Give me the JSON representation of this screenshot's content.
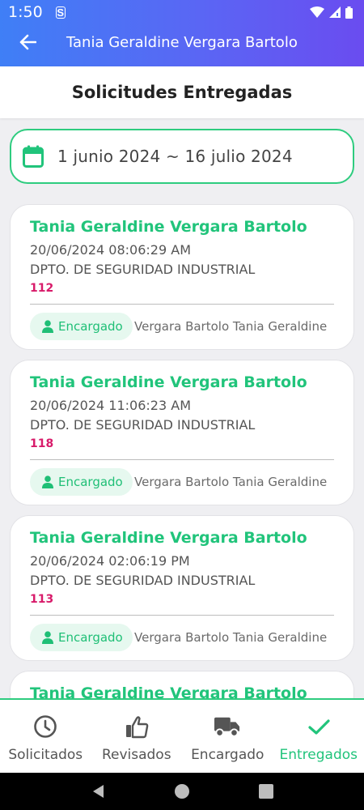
{
  "status": {
    "time": "1:50",
    "sim_label": "S"
  },
  "appbar": {
    "title": "Tania Geraldine Vergara Bartolo"
  },
  "header": {
    "title": "Solicitudes Entregadas"
  },
  "date_filter": {
    "range": "1 junio 2024 ~ 16 julio 2024"
  },
  "requests": [
    {
      "name": "Tania Geraldine Vergara Bartolo",
      "datetime": "20/06/2024 08:06:29 AM",
      "department": "DPTO. DE SEGURIDAD INDUSTRIAL",
      "number": "112",
      "role": "Encargado",
      "person": "Vergara Bartolo Tania Geraldine"
    },
    {
      "name": "Tania Geraldine Vergara Bartolo",
      "datetime": "20/06/2024 11:06:23 AM",
      "department": "DPTO. DE SEGURIDAD INDUSTRIAL",
      "number": "118",
      "role": "Encargado",
      "person": "Vergara Bartolo Tania Geraldine"
    },
    {
      "name": "Tania Geraldine Vergara Bartolo",
      "datetime": "20/06/2024 02:06:19 PM",
      "department": "DPTO. DE SEGURIDAD INDUSTRIAL",
      "number": "113",
      "role": "Encargado",
      "person": "Vergara Bartolo Tania Geraldine"
    },
    {
      "name": "Tania Geraldine Vergara Bartolo",
      "datetime": "",
      "department": "",
      "number": "",
      "role": "",
      "person": ""
    }
  ],
  "bottom_nav": [
    {
      "label": "Solicitados",
      "icon": "clock-icon",
      "active": false
    },
    {
      "label": "Revisados",
      "icon": "thumbs-up-icon",
      "active": false
    },
    {
      "label": "Encargado",
      "icon": "truck-icon",
      "active": false
    },
    {
      "label": "Entregados",
      "icon": "check-icon",
      "active": true
    }
  ],
  "colors": {
    "accent": "#21c47b",
    "number": "#d81b6a",
    "appbar_start": "#3f7ff6",
    "appbar_end": "#6a4cf0"
  }
}
